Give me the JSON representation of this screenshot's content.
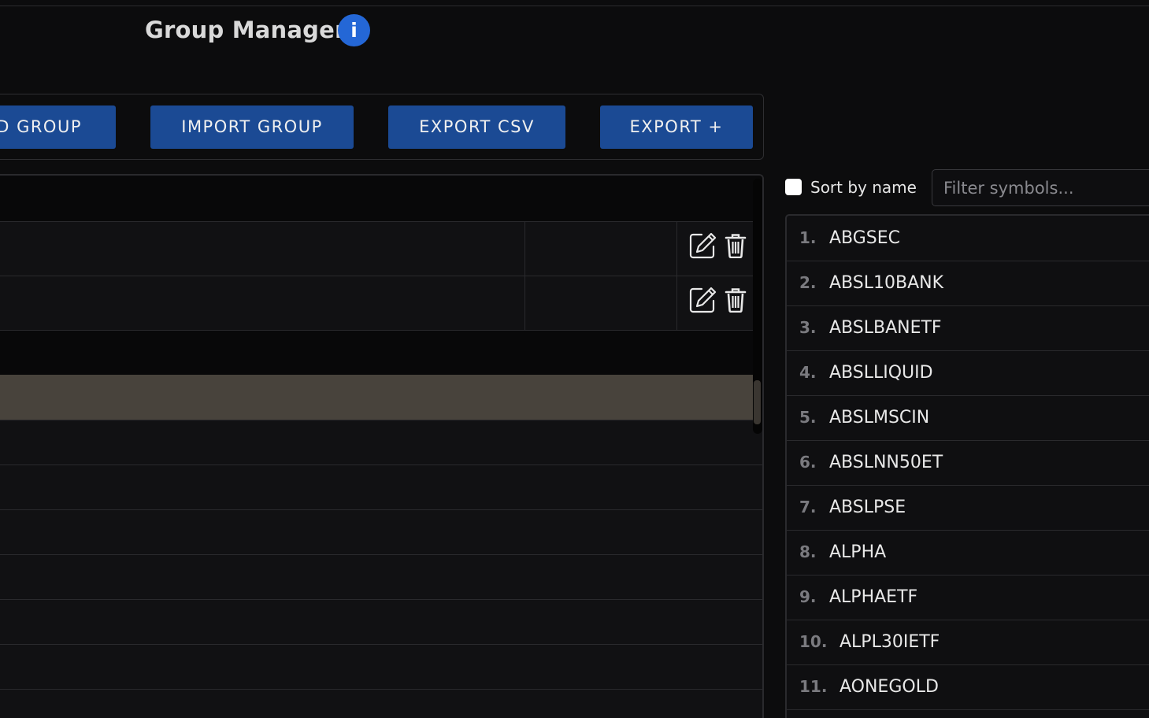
{
  "header": {
    "title": "Group Manager",
    "info_icon": "info-icon",
    "info_glyph": "i",
    "accent_color": "#2467d6"
  },
  "toolbar": {
    "add_group_label": "D GROUP",
    "import_group_label": "IMPORT GROUP",
    "export_csv_label": "EXPORT CSV",
    "export_plus_label": "EXPORT +",
    "button_color": "#1b4a94"
  },
  "group_table": {
    "rows": [
      {
        "actions": [
          "edit-icon",
          "trash-icon"
        ]
      },
      {
        "actions": [
          "edit-icon",
          "trash-icon"
        ]
      }
    ],
    "highlight_color": "#48433c"
  },
  "symbols_panel": {
    "sort_label": "Sort by name",
    "sort_checked": false,
    "filter_placeholder": "Filter symbols...",
    "items": [
      {
        "num": "1.",
        "name": "ABGSEC"
      },
      {
        "num": "2.",
        "name": "ABSL10BANK"
      },
      {
        "num": "3.",
        "name": "ABSLBANETF"
      },
      {
        "num": "4.",
        "name": "ABSLLIQUID"
      },
      {
        "num": "5.",
        "name": "ABSLMSCIN"
      },
      {
        "num": "6.",
        "name": "ABSLNN50ET"
      },
      {
        "num": "7.",
        "name": "ABSLPSE"
      },
      {
        "num": "8.",
        "name": "ALPHA"
      },
      {
        "num": "9.",
        "name": "ALPHAETF"
      },
      {
        "num": "10.",
        "name": "ALPL30IETF"
      },
      {
        "num": "11.",
        "name": "AONEGOLD"
      }
    ]
  }
}
